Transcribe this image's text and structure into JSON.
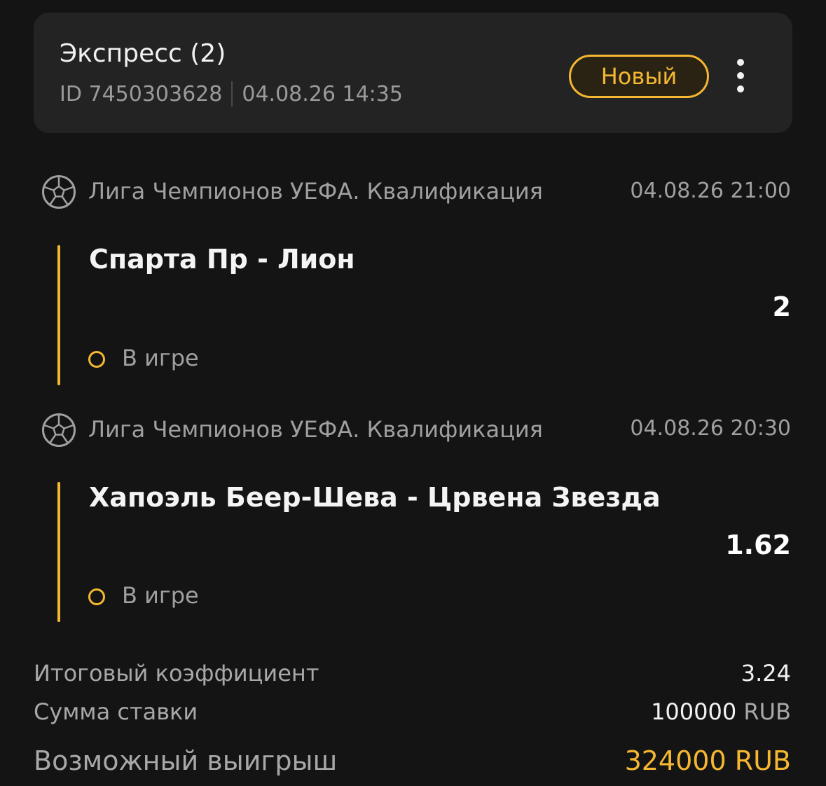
{
  "header": {
    "title": "Экспресс (2)",
    "id_text": "ID 7450303628",
    "datetime": "04.08.26 14:35",
    "status": "Новый",
    "more_icon": "more-vertical-icon"
  },
  "events": [
    {
      "league": "Лига Чемпионов УЕФА. Квалификация",
      "league_icon": "soccer-ball-icon",
      "date": "04.08.26 21:00",
      "match": "Спарта Пр - Лион",
      "odds": "2",
      "status": "В игре"
    },
    {
      "league": "Лига Чемпионов УЕФА. Квалификация",
      "league_icon": "soccer-ball-icon",
      "date": "04.08.26 20:30",
      "match": "Хапоэль Беер-Шева - Црвена Звезда",
      "odds": "1.62",
      "status": "В игре"
    }
  ],
  "summary": {
    "total_odds_label": "Итоговый коэффициент",
    "total_odds_value": "3.24",
    "stake_label": "Сумма ставки",
    "stake_amount": "100000",
    "stake_currency": "RUB",
    "winnings_label": "Возможный выигрыш",
    "winnings_value": "324000 RUB"
  },
  "colors": {
    "accent": "#f5b731",
    "background": "#141414",
    "card": "#232323",
    "muted_text": "#a0a0a0"
  }
}
